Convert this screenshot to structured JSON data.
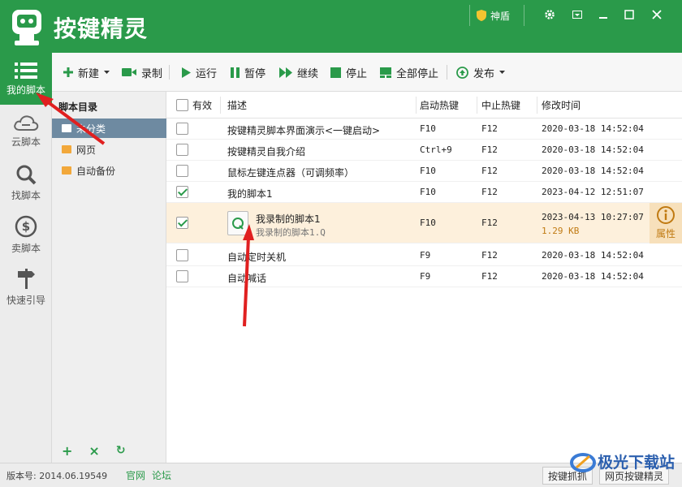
{
  "app": {
    "title": "按键精灵"
  },
  "header": {
    "shield_label": "神盾"
  },
  "rail": [
    {
      "label": "我的脚本",
      "icon": "list-icon",
      "active": true
    },
    {
      "label": "云脚本",
      "icon": "cloud-icon"
    },
    {
      "label": "找脚本",
      "icon": "search-icon"
    },
    {
      "label": "卖脚本",
      "icon": "dollar-icon"
    },
    {
      "label": "快速引导",
      "icon": "signpost-icon"
    }
  ],
  "toolbar": {
    "new": "新建",
    "record": "录制",
    "run": "运行",
    "pause": "暂停",
    "resume": "继续",
    "stop": "停止",
    "stop_all": "全部停止",
    "publish": "发布"
  },
  "directory": {
    "title": "脚本目录",
    "items": [
      "未分类",
      "网页",
      "自动备份"
    ],
    "selected": 0
  },
  "table": {
    "headers": {
      "enabled": "有效",
      "desc": "描述",
      "start_hotkey": "启动热键",
      "stop_hotkey": "中止热键",
      "modified": "修改时间"
    },
    "rows": [
      {
        "checked": false,
        "desc": "按键精灵脚本界面演示<一键启动>",
        "start": "F10",
        "stop": "F12",
        "time": "2020-03-18 14:52:04"
      },
      {
        "checked": false,
        "desc": "按键精灵自我介绍",
        "start": "Ctrl+9",
        "stop": "F12",
        "time": "2020-03-18 14:52:04"
      },
      {
        "checked": false,
        "desc": "鼠标左键连点器（可调频率）",
        "start": "F10",
        "stop": "F12",
        "time": "2020-03-18 14:52:04"
      },
      {
        "checked": true,
        "desc": "我的脚本1",
        "start": "F10",
        "stop": "F12",
        "time": "2023-04-12 12:51:07"
      },
      {
        "checked": true,
        "desc": "我录制的脚本1",
        "file": "我录制的脚本1.Q",
        "start": "F10",
        "stop": "F12",
        "time": "2023-04-13 10:27:07",
        "size": "1.29 KB",
        "highlighted": true,
        "action": "属性"
      },
      {
        "checked": false,
        "desc": "自动定时关机",
        "start": "F9",
        "stop": "F12",
        "time": "2020-03-18 14:52:04"
      },
      {
        "checked": false,
        "desc": "自动喊话",
        "start": "F9",
        "stop": "F12",
        "time": "2020-03-18 14:52:04"
      }
    ]
  },
  "status": {
    "version": "版本号: 2014.06.19549",
    "official_site": "官网",
    "forum": "论坛",
    "capture_btn": "按键抓抓",
    "web_btn": "网页按键精灵"
  },
  "watermark": {
    "text": "极光下载站"
  },
  "colors": {
    "brand": "#2a9a4a",
    "highlight_row": "#fdf0dc",
    "annotation_arrow": "#e02020"
  }
}
